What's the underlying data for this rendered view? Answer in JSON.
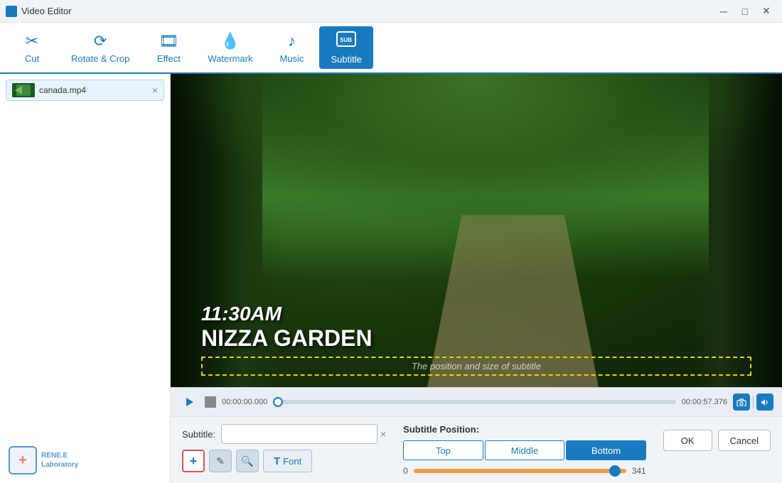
{
  "window": {
    "title": "Video Editor",
    "minimize": "─",
    "maximize": "□",
    "close": "✕"
  },
  "toolbar": {
    "items": [
      {
        "id": "cut",
        "label": "Cut",
        "icon": "✂"
      },
      {
        "id": "rotate-crop",
        "label": "Rotate & Crop",
        "icon": "⟳"
      },
      {
        "id": "effect",
        "label": "Effect",
        "icon": "🎞"
      },
      {
        "id": "watermark",
        "label": "Watermark",
        "icon": "💧"
      },
      {
        "id": "music",
        "label": "Music",
        "icon": "♪"
      },
      {
        "id": "subtitle",
        "label": "Subtitle",
        "icon": "SUB",
        "active": true
      }
    ]
  },
  "file_tab": {
    "filename": "canada.mp4",
    "close": "×"
  },
  "video": {
    "subtitle_text": "11:30AM",
    "subtitle_name": "NIZZA GARDEN",
    "subtitle_hint": "The position and size of subtitle",
    "time_start": "00:00:00.000",
    "time_end": "00:00:57.376"
  },
  "subtitle_panel": {
    "label": "Subtitle:",
    "placeholder": "",
    "clear_icon": "×",
    "add_label": "+",
    "edit_icon": "✎",
    "search_icon": "🔍",
    "font_icon": "T",
    "font_label": "Font"
  },
  "position_panel": {
    "title": "Subtitle Position:",
    "buttons": [
      "Top",
      "Middle",
      "Bottom"
    ],
    "active_button": "Bottom",
    "slider_min": "0",
    "slider_max": "341"
  },
  "dialog": {
    "ok_label": "OK",
    "cancel_label": "Cancel"
  },
  "logo": {
    "text": "RENE.E\nLaboratory",
    "icon": "+"
  }
}
